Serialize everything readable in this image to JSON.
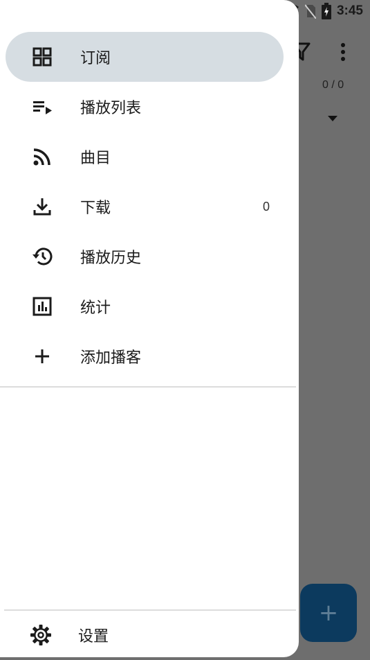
{
  "status_bar": {
    "time": "3:45",
    "icons": [
      "wifi-icon",
      "no-sim-icon",
      "battery-charging-icon"
    ]
  },
  "background": {
    "toolbar_icons": [
      "filter-icon",
      "more-vert-icon"
    ],
    "counter": "0 / 0",
    "dropdown_icon": "arrow-drop-down-icon",
    "fab_icon": "add-icon",
    "colors": {
      "scrim": "#6e6e6e",
      "fab": "#0c3a5e"
    }
  },
  "drawer": {
    "items": [
      {
        "label": "订阅",
        "icon": "grid-icon",
        "active": true,
        "badge": ""
      },
      {
        "label": "播放列表",
        "icon": "playlist-icon",
        "active": false,
        "badge": ""
      },
      {
        "label": "曲目",
        "icon": "rss-feed-icon",
        "active": false,
        "badge": ""
      },
      {
        "label": "下载",
        "icon": "download-icon",
        "active": false,
        "badge": "0"
      },
      {
        "label": "播放历史",
        "icon": "history-icon",
        "active": false,
        "badge": ""
      },
      {
        "label": "统计",
        "icon": "statistics-icon",
        "active": false,
        "badge": ""
      },
      {
        "label": "添加播客",
        "icon": "add-icon",
        "active": false,
        "badge": ""
      }
    ],
    "settings": {
      "label": "设置",
      "icon": "settings-gear-icon"
    },
    "colors": {
      "active_background": "#d6dde2",
      "surface": "#ffffff"
    }
  }
}
